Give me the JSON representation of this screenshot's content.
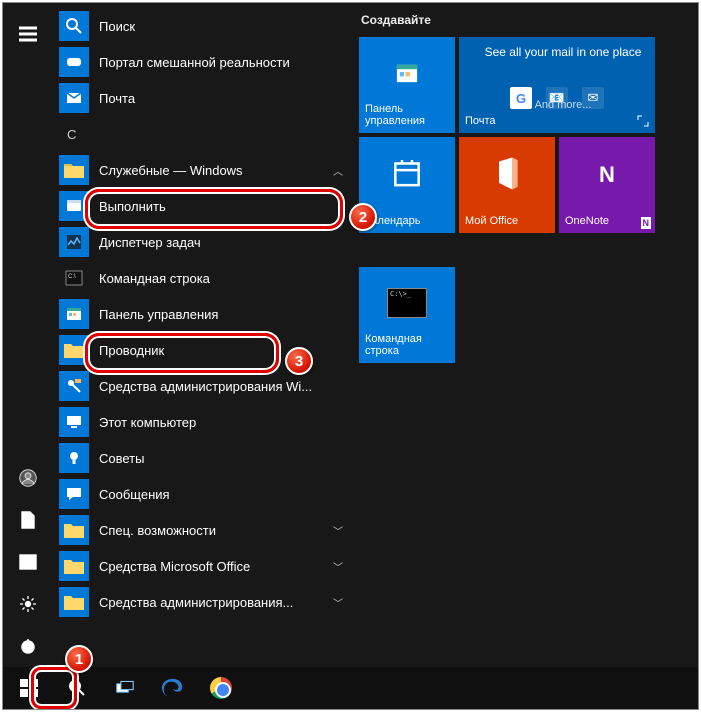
{
  "section_letter": "С",
  "apps_above": [
    {
      "label": "Поиск",
      "icon": "search"
    },
    {
      "label": "Портал смешанной реальности",
      "icon": "mr"
    },
    {
      "label": "Почта",
      "icon": "mail"
    }
  ],
  "system_folder": {
    "label": "Служебные — Windows"
  },
  "sub_items": [
    {
      "label": "Выполнить",
      "icon": "run"
    },
    {
      "label": "Диспетчер задач",
      "icon": "taskmgr"
    },
    {
      "label": "Командная строка",
      "icon": "cmd"
    },
    {
      "label": "Панель управления",
      "icon": "cpanel"
    },
    {
      "label": "Проводник",
      "icon": "explorer"
    },
    {
      "label": "Средства администрирования Wi...",
      "icon": "admin"
    },
    {
      "label": "Этот компьютер",
      "icon": "pc"
    }
  ],
  "apps_below": [
    {
      "label": "Советы",
      "icon": "tips",
      "chev": false
    },
    {
      "label": "Сообщения",
      "icon": "messages",
      "chev": false
    },
    {
      "label": "Спец. возможности",
      "icon": "folder",
      "chev": true
    },
    {
      "label": "Средства Microsoft Office",
      "icon": "folder",
      "chev": true
    },
    {
      "label": "Средства администрирования...",
      "icon": "folder",
      "chev": true
    }
  ],
  "tiles_group": "Создавайте",
  "tiles": {
    "cpanel": "Панель управления",
    "mail_wide_top": "See all your mail in one place",
    "mail_wide_bottom": "And more...",
    "mail_label": "Почта",
    "calendar": "Календарь",
    "myoffice": "Мой Office",
    "onenote": "OneNote",
    "cmd": "Командная строка"
  },
  "badges": {
    "1": "1",
    "2": "2",
    "3": "3"
  }
}
